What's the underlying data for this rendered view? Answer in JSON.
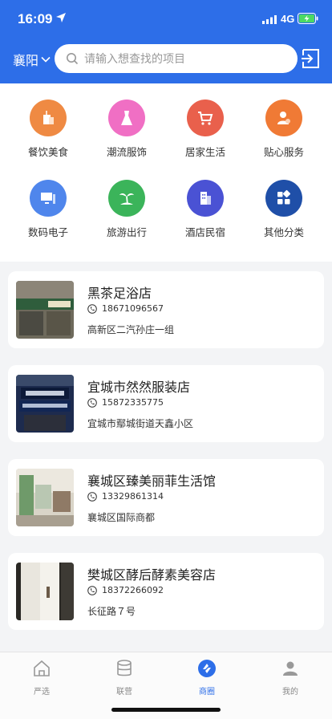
{
  "status": {
    "time": "16:09",
    "network": "4G"
  },
  "header": {
    "city": "襄阳",
    "search_placeholder": "请输入想查找的项目"
  },
  "categories": [
    {
      "label": "餐饮美食",
      "color": "#ef8a43",
      "icon": "food-icon"
    },
    {
      "label": "潮流服饰",
      "color": "#f06fc4",
      "icon": "dress-icon"
    },
    {
      "label": "居家生活",
      "color": "#e9604c",
      "icon": "cart-icon"
    },
    {
      "label": "贴心服务",
      "color": "#f07a35",
      "icon": "service-icon"
    },
    {
      "label": "数码电子",
      "color": "#4f86ec",
      "icon": "computer-icon"
    },
    {
      "label": "旅游出行",
      "color": "#3bb45a",
      "icon": "beach-icon"
    },
    {
      "label": "酒店民宿",
      "color": "#4a52d4",
      "icon": "hotel-icon"
    },
    {
      "label": "其他分类",
      "color": "#1f4fa8",
      "icon": "grid-icon"
    }
  ],
  "shops": [
    {
      "name": "黑茶足浴店",
      "phone": "18671096567",
      "address": "高新区二汽孙庄一组"
    },
    {
      "name": "宜城市然然服装店",
      "phone": "15872335775",
      "address": "宜城市鄢城街道天鑫小区"
    },
    {
      "name": "襄城区臻美丽菲生活馆",
      "phone": "13329861314",
      "address": "襄城区国际商都"
    },
    {
      "name": "樊城区酵后酵素美容店",
      "phone": "18372266092",
      "address": "长征路７号"
    }
  ],
  "tabs": [
    {
      "label": "严选",
      "icon": "home-icon"
    },
    {
      "label": "联营",
      "icon": "database-icon"
    },
    {
      "label": "商圈",
      "icon": "shop-circle-icon",
      "active": true
    },
    {
      "label": "我的",
      "icon": "user-icon"
    }
  ],
  "colors": {
    "primary": "#2d6ee8",
    "background": "#f3f4f6"
  }
}
